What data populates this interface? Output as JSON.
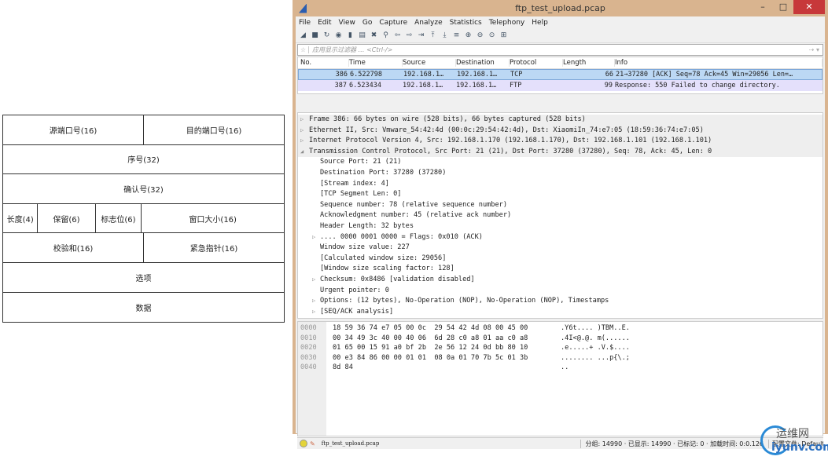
{
  "diagram": {
    "rows": [
      [
        "源端口号(16)",
        "目的端口号(16)"
      ],
      [
        "序号(32)"
      ],
      [
        "确认号(32)"
      ],
      [
        "长度(4)",
        "保留(6)",
        "标志位(6)",
        "窗口大小(16)"
      ],
      [
        "校验和(16)",
        "紧急指针(16)"
      ],
      [
        "选项"
      ],
      [
        "数据"
      ]
    ]
  },
  "window": {
    "title": "ftp_test_upload.pcap",
    "minimize": "–",
    "maximize": "□",
    "close": "✕"
  },
  "menu": [
    "File",
    "Edit",
    "View",
    "Go",
    "Capture",
    "Analyze",
    "Statistics",
    "Telephony",
    "Help"
  ],
  "toolbar": [
    "◢",
    "■",
    "↻",
    "◉",
    "▮",
    "▤",
    "✖",
    "⚲",
    "⇦",
    "⇨",
    "⇥",
    "⤒",
    "⤓",
    "≡",
    "⊕",
    "⊖",
    "⊙",
    "⊞"
  ],
  "filter": {
    "placeholder": "应用显示过滤器 … <Ctrl-/>",
    "apply": "⇢ ▾",
    "star": "☆"
  },
  "packet_list": {
    "headers": [
      "No.",
      "Time",
      "Source",
      "Destination",
      "Protocol",
      "Length",
      "Info"
    ],
    "rows": [
      [
        "386",
        "6.522798",
        "192.168.1…",
        "192.168.1…",
        "TCP",
        "66",
        "21→37280 [ACK] Seq=78 Ack=45 Win=29056 Len=…"
      ],
      [
        "387",
        "6.523434",
        "192.168.1…",
        "192.168.1…",
        "FTP",
        "99",
        "Response: 550 Failed to change directory."
      ]
    ]
  },
  "details": [
    {
      "t": "Frame 386: 66 bytes on wire (528 bits), 66 bytes captured (528 bits)",
      "lvl": 0,
      "tw": "▷"
    },
    {
      "t": "Ethernet II, Src: Vmware_54:42:4d (00:0c:29:54:42:4d), Dst: XiaomiIn_74:e7:05 (18:59:36:74:e7:05)",
      "lvl": 0,
      "tw": "▷"
    },
    {
      "t": "Internet Protocol Version 4, Src: 192.168.1.170 (192.168.1.170), Dst: 192.168.1.101 (192.168.1.101)",
      "lvl": 0,
      "tw": "▷"
    },
    {
      "t": "Transmission Control Protocol, Src Port: 21 (21), Dst Port: 37280 (37280), Seq: 78, Ack: 45, Len: 0",
      "lvl": 0,
      "tw": "◢"
    },
    {
      "t": "Source Port: 21 (21)",
      "lvl": 1,
      "tw": ""
    },
    {
      "t": "Destination Port: 37280 (37280)",
      "lvl": 1,
      "tw": ""
    },
    {
      "t": "[Stream index: 4]",
      "lvl": 1,
      "tw": ""
    },
    {
      "t": "[TCP Segment Len: 0]",
      "lvl": 1,
      "tw": ""
    },
    {
      "t": "Sequence number: 78    (relative sequence number)",
      "lvl": 1,
      "tw": ""
    },
    {
      "t": "Acknowledgment number: 45    (relative ack number)",
      "lvl": 1,
      "tw": ""
    },
    {
      "t": "Header Length: 32 bytes",
      "lvl": 1,
      "tw": ""
    },
    {
      "t": ".... 0000 0001 0000 = Flags: 0x010 (ACK)",
      "lvl": 1,
      "tw": "▷"
    },
    {
      "t": "Window size value: 227",
      "lvl": 1,
      "tw": ""
    },
    {
      "t": "[Calculated window size: 29056]",
      "lvl": 1,
      "tw": ""
    },
    {
      "t": "[Window size scaling factor: 128]",
      "lvl": 1,
      "tw": ""
    },
    {
      "t": "Checksum: 0x8486 [validation disabled]",
      "lvl": 1,
      "tw": "▷"
    },
    {
      "t": "Urgent pointer: 0",
      "lvl": 1,
      "tw": ""
    },
    {
      "t": "Options: (12 bytes), No-Operation (NOP), No-Operation (NOP), Timestamps",
      "lvl": 1,
      "tw": "▷"
    },
    {
      "t": "[SEQ/ACK analysis]",
      "lvl": 1,
      "tw": "▷"
    }
  ],
  "hex": {
    "offsets": [
      "0000",
      "0010",
      "0020",
      "0030",
      "0040"
    ],
    "bytes": [
      "18 59 36 74 e7 05 00 0c  29 54 42 4d 08 00 45 00",
      "00 34 49 3c 40 00 40 06  6d 28 c0 a8 01 aa c0 a8",
      "01 65 00 15 91 a0 bf 2b  2e 56 12 24 0d bb 80 10",
      "00 e3 84 86 00 00 01 01  08 0a 01 70 7b 5c 01 3b",
      "8d 84"
    ],
    "ascii": [
      ".Y6t.... )TBM..E.",
      ".4I<@.@. m(......",
      ".e.....+ .V.$....",
      "........ ...p{\\.;",
      ".."
    ]
  },
  "status": {
    "file": "ftp_test_upload.pcap",
    "stats": "分组: 14990 · 已显示: 14990 · 已标记: 0 · 加载时间: 0:0.126",
    "profile": "配置文件: Default"
  },
  "watermark": {
    "cn": "运维网",
    "en": "iyunv.com"
  }
}
